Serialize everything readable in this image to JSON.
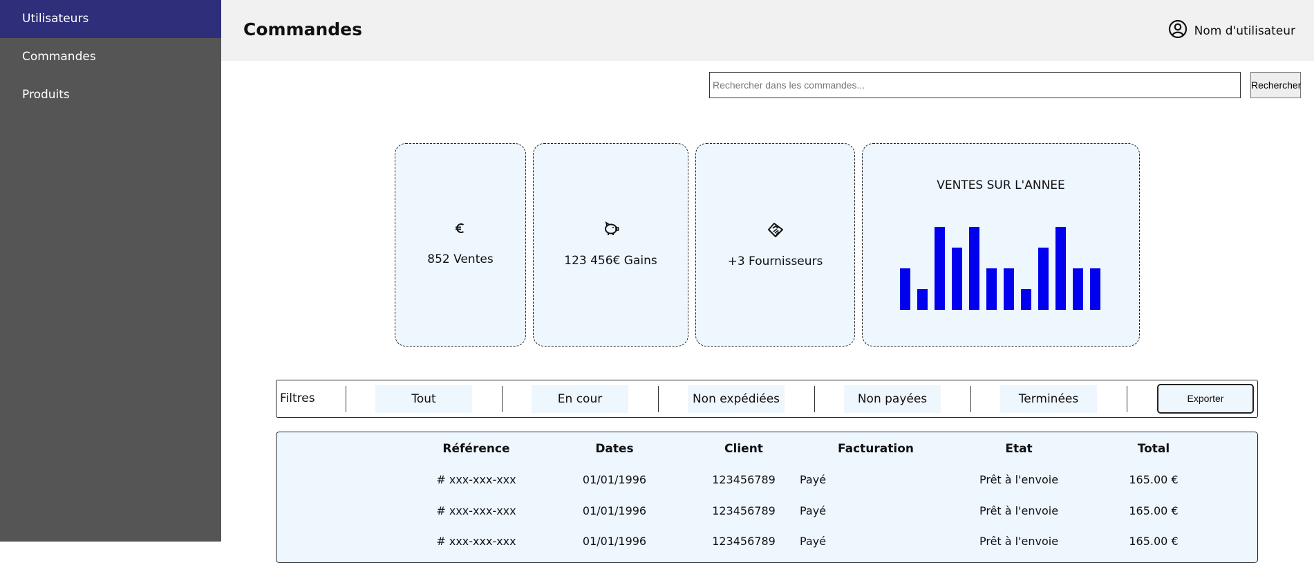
{
  "sidebar": {
    "items": [
      {
        "label": "Utilisateurs",
        "active": true
      },
      {
        "label": "Commandes",
        "active": false
      },
      {
        "label": "Produits",
        "active": false
      }
    ],
    "background": "#555555",
    "active_color": "#2e2e7a"
  },
  "header": {
    "title": "Commandes",
    "user_name": "Nom d'utilisateur",
    "user_icon": "user-circle-icon"
  },
  "search": {
    "placeholder": "Rechercher dans les commandes...",
    "value": "",
    "button_label": "Rechercher"
  },
  "cards": [
    {
      "icon": "euro-icon",
      "text": "852 Ventes"
    },
    {
      "icon": "piggy-bank-icon",
      "text": "123 456€ Gains"
    },
    {
      "icon": "handshake-icon",
      "text": "+3 Fournisseurs"
    }
  ],
  "chart": {
    "title": "VENTES SUR L'ANNEE",
    "bar_color": "#0000ee"
  },
  "chart_data": {
    "type": "bar",
    "title": "VENTES SUR L'ANNEE",
    "categories": [],
    "values": [
      2,
      1,
      4,
      3,
      4,
      2,
      2,
      1,
      3,
      4,
      2,
      2
    ],
    "ylim": [
      0,
      4
    ],
    "grid": false,
    "legend": "none"
  },
  "filters": {
    "label": "Filtres",
    "options": [
      "Tout",
      "En cour",
      "Non expédiées",
      "Non payées",
      "Terminées"
    ],
    "export_label": "Exporter"
  },
  "table": {
    "columns": [
      "Référence",
      "Dates",
      "Client",
      "Facturation",
      "Etat",
      "Total"
    ],
    "rows": [
      [
        "# xxx-xxx-xxx",
        "01/01/1996",
        "123456789",
        "Payé",
        "Prêt à l'envoie",
        "165.00 €"
      ],
      [
        "# xxx-xxx-xxx",
        "01/01/1996",
        "123456789",
        "Payé",
        "Prêt à l'envoie",
        "165.00 €"
      ],
      [
        "# xxx-xxx-xxx",
        "01/01/1996",
        "123456789",
        "Payé",
        "Prêt à l'envoie",
        "165.00 €"
      ]
    ]
  }
}
